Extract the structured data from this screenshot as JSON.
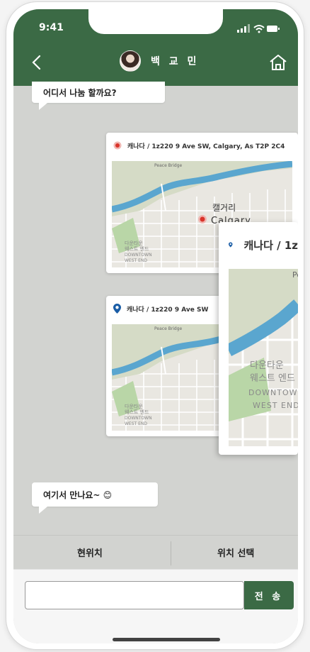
{
  "status": {
    "time": "9:41"
  },
  "header": {
    "title": "백 교 민",
    "back_icon": "chevron-left-icon",
    "home_icon": "home-icon"
  },
  "messages": [
    {
      "side": "left",
      "text": "어디서 나눔 할까요?"
    },
    {
      "side": "right",
      "type": "location",
      "address": "캐나다 / 1z220 9 Ave SW, Calgary, As T2P 2C4",
      "map_label_ko": "캘거리",
      "map_label_en": "Calgary"
    },
    {
      "side": "right",
      "type": "location",
      "address": "캐나다 / 1z220 9 Ave SW"
    },
    {
      "side": "left",
      "text": "여기서 만나요~ 😊"
    }
  ],
  "zoom_card": {
    "address": "캐나다 / 1z",
    "map_label_1": "다운타운",
    "map_label_2": "웨스트 엔드",
    "map_label_3": "DOWNTOWN",
    "map_label_4": "WEST END",
    "map_label_5": "Peace"
  },
  "map_small_labels": {
    "bridge": "Peace Bridge",
    "l1": "다운타운",
    "l2": "웨스트 엔드",
    "l3": "DOWNTOWN",
    "l4": "WEST END"
  },
  "tabs": {
    "current_location": "현위치",
    "select_location": "위치 선택"
  },
  "input": {
    "placeholder": "",
    "value": ""
  },
  "send_label": "전 송",
  "colors": {
    "brand": "#3b6a45",
    "bg": "#d2d3d0",
    "pin_red": "#d9342b",
    "pin_blue": "#1a5da6"
  }
}
